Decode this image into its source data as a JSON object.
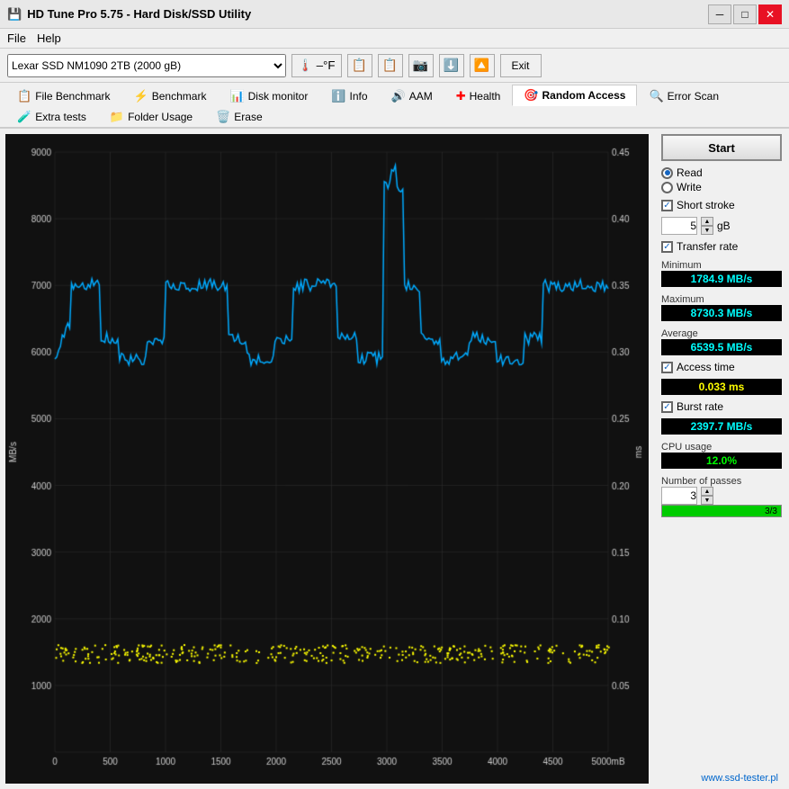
{
  "window": {
    "title": "HD Tune Pro 5.75 - Hard Disk/SSD Utility",
    "icon": "💾"
  },
  "menu": {
    "items": [
      "File",
      "Help"
    ]
  },
  "toolbar": {
    "drive": "Lexar SSD NM1090 2TB (2000 gB)",
    "temp_label": "–°F",
    "exit_label": "Exit"
  },
  "tabs": [
    {
      "id": "file-benchmark",
      "label": "File Benchmark",
      "icon": "📋",
      "active": false
    },
    {
      "id": "benchmark",
      "label": "Benchmark",
      "icon": "⚡",
      "active": false
    },
    {
      "id": "disk-monitor",
      "label": "Disk monitor",
      "icon": "📊",
      "active": false
    },
    {
      "id": "info",
      "label": "Info",
      "icon": "ℹ️",
      "active": false
    },
    {
      "id": "aam",
      "label": "AAM",
      "icon": "🔊",
      "active": false
    },
    {
      "id": "health",
      "label": "Health",
      "icon": "➕",
      "active": false
    },
    {
      "id": "random-access",
      "label": "Random Access",
      "icon": "🎯",
      "active": true
    },
    {
      "id": "error-scan",
      "label": "Error Scan",
      "icon": "🔍",
      "active": false
    },
    {
      "id": "extra-tests",
      "label": "Extra tests",
      "icon": "🧪",
      "active": false
    },
    {
      "id": "folder-usage",
      "label": "Folder Usage",
      "icon": "📁",
      "active": false
    },
    {
      "id": "erase",
      "label": "Erase",
      "icon": "🗑️",
      "active": false
    }
  ],
  "chart": {
    "y_left_label": "MB/s",
    "y_right_label": "ms",
    "y_left_values": [
      "9000",
      "8000",
      "7000",
      "6000",
      "5000",
      "4000",
      "3000",
      "2000",
      "1000",
      ""
    ],
    "y_right_values": [
      "0.45",
      "0.40",
      "0.35",
      "0.30",
      "0.25",
      "0.20",
      "0.15",
      "0.10",
      "0.05"
    ],
    "x_values": [
      "0",
      "500",
      "1000",
      "1500",
      "2000",
      "2500",
      "3000",
      "3500",
      "4000",
      "4500",
      "5000mB"
    ]
  },
  "controls": {
    "start_label": "Start",
    "read_label": "Read",
    "write_label": "Write",
    "short_stroke_label": "Short stroke",
    "short_stroke_value": "5",
    "short_stroke_unit": "gB",
    "transfer_rate_label": "Transfer rate",
    "minimum_label": "Minimum",
    "minimum_value": "1784.9 MB/s",
    "maximum_label": "Maximum",
    "maximum_value": "8730.3 MB/s",
    "average_label": "Average",
    "average_value": "6539.5 MB/s",
    "access_time_label": "Access time",
    "access_time_value": "0.033 ms",
    "burst_rate_label": "Burst rate",
    "burst_rate_value": "2397.7 MB/s",
    "cpu_usage_label": "CPU usage",
    "cpu_usage_value": "12.0%",
    "passes_label": "Number of passes",
    "passes_value": "3",
    "passes_progress": "3/3",
    "passes_percent": 100
  },
  "website": "www.ssd-tester.pl"
}
